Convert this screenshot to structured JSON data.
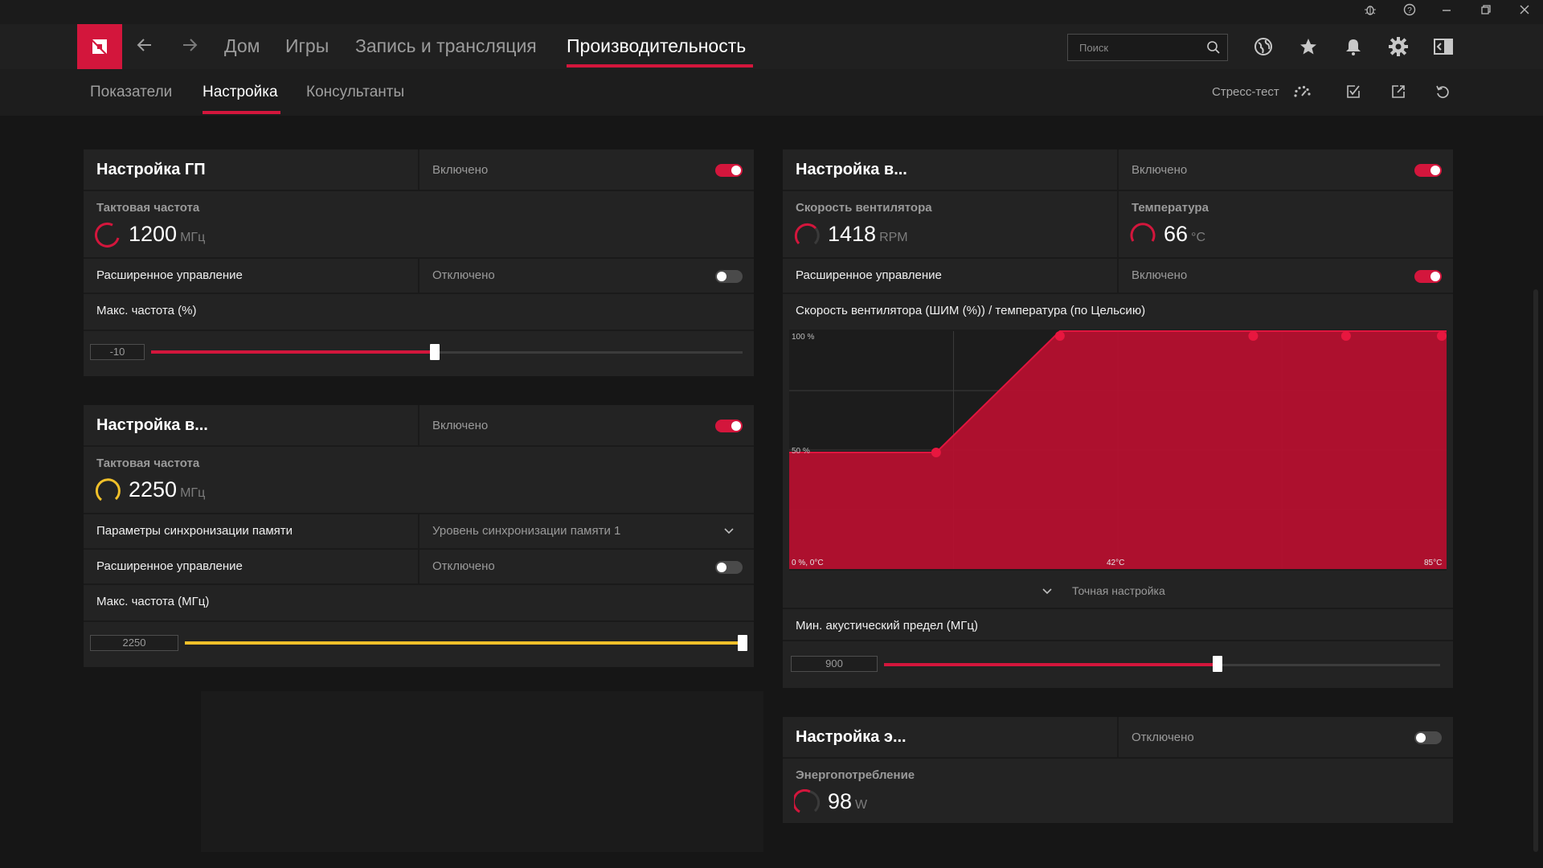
{
  "window": {
    "controls": [
      "bug-icon",
      "help-icon",
      "minimize-icon",
      "restore-icon",
      "close-icon"
    ]
  },
  "nav": {
    "items": [
      {
        "label": "Дом"
      },
      {
        "label": "Игры"
      },
      {
        "label": "Запись и трансляция"
      },
      {
        "label": "Производительность",
        "active": true
      }
    ],
    "search_placeholder": "Поиск"
  },
  "subnav": {
    "items": [
      {
        "label": "Показатели"
      },
      {
        "label": "Настройка",
        "active": true
      },
      {
        "label": "Консультанты"
      }
    ],
    "stress_test": "Стресс-тест"
  },
  "colors": {
    "accent": "#d3163c",
    "memory": "#f0c02a",
    "panel": "#232323",
    "background": "#161616"
  },
  "gpu": {
    "title": "Настройка ГП",
    "status": "Включено",
    "enabled": true,
    "clock_label": "Тактовая частота",
    "clock_value": "1200",
    "clock_unit": "МГц",
    "advanced_label": "Расширенное управление",
    "advanced_status": "Отключено",
    "max_label": "Макс. частота (%)",
    "max_value": "-10",
    "max_fraction": 0.48
  },
  "vram": {
    "title": "Настройка в...",
    "status": "Включено",
    "enabled": true,
    "clock_label": "Тактовая частота",
    "clock_value": "2250",
    "clock_unit": "МГц",
    "timing_label": "Параметры синхронизации памяти",
    "timing_value": "Уровень синхронизации памяти 1",
    "advanced_label": "Расширенное управление",
    "advanced_status": "Отключено",
    "max_label": "Макс. частота (МГц)",
    "max_value": "2250",
    "max_fraction": 1.0
  },
  "fan": {
    "title": "Настройка в...",
    "status": "Включено",
    "enabled": true,
    "speed_label": "Скорость вентилятора",
    "speed_value": "1418",
    "speed_unit": "RPM",
    "temp_label": "Температура",
    "temp_value": "66",
    "temp_unit": "°C",
    "advanced_label": "Расширенное управление",
    "advanced_status": "Включено",
    "advanced_enabled": true,
    "curve_label": "Скорость вентилятора (ШИМ (%)) / температура (по Цельсию)",
    "fine_tune": "Точная настройка",
    "acoustic_label": "Мин. акустический предел (МГц)",
    "acoustic_value": "900",
    "acoustic_fraction": 0.6
  },
  "power": {
    "title": "Настройка э...",
    "status": "Отключено",
    "enabled": false,
    "label": "Энергопотребление",
    "value": "98",
    "unit": "W"
  },
  "chart_data": {
    "type": "area",
    "title": "",
    "xlabel": "",
    "ylabel": "",
    "xlim": [
      0,
      85
    ],
    "ylim": [
      0,
      100
    ],
    "y_tick_labels": [
      "100 %",
      "50 %"
    ],
    "x_tick_labels": [
      "0 %, 0°C",
      "42°C",
      "85°C"
    ],
    "series": [
      {
        "x": [
          0,
          19,
          35,
          60,
          72,
          85
        ],
        "y": [
          49,
          49,
          100,
          100,
          100,
          100
        ]
      }
    ],
    "points": [
      {
        "x": 19,
        "y": 49
      },
      {
        "x": 35,
        "y": 100
      },
      {
        "x": 60,
        "y": 100
      },
      {
        "x": 72,
        "y": 100
      },
      {
        "x": 85,
        "y": 100
      }
    ],
    "grid": true
  }
}
